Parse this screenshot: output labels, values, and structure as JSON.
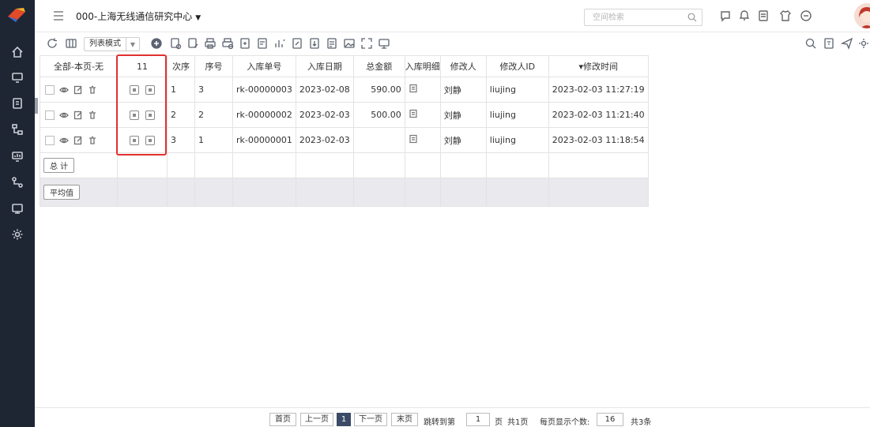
{
  "topbar": {
    "org_name": "000-上海无线通信研究中心",
    "search_placeholder": "空间检索"
  },
  "toolbar": {
    "view_mode": "列表模式"
  },
  "table": {
    "headers": [
      "全部-本页-无",
      "11",
      "次序",
      "序号",
      "入库单号",
      "入库日期",
      "总金额",
      "入库明细",
      "修改人",
      "修改人ID",
      "▾修改时间"
    ],
    "rows": [
      {
        "order": "1",
        "seq": "3",
        "code": "rk-00000003",
        "date": "2023-02-08",
        "amount": "590.00",
        "modifier": "刘静",
        "modifier_id": "liujing",
        "modified_time": "2023-02-03 11:27:19"
      },
      {
        "order": "2",
        "seq": "2",
        "code": "rk-00000002",
        "date": "2023-02-03",
        "amount": "500.00",
        "modifier": "刘静",
        "modifier_id": "liujing",
        "modified_time": "2023-02-03 11:21:40"
      },
      {
        "order": "3",
        "seq": "1",
        "code": "rk-00000001",
        "date": "2023-02-03",
        "amount": "",
        "modifier": "刘静",
        "modifier_id": "liujing",
        "modified_time": "2023-02-03 11:18:54"
      }
    ],
    "total_label": "总 计",
    "average_label": "平均值"
  },
  "pager": {
    "first": "首页",
    "prev": "上一页",
    "current": "1",
    "next": "下一页",
    "last": "末页",
    "jump_label": "跳转到第",
    "jump_value": "1",
    "page_unit": "页",
    "total_pages": "共1页",
    "per_page_label": "每页显示个数:",
    "per_page_value": "16",
    "total_items": "共3条"
  },
  "colors": {
    "rail_bg": "#1f2633",
    "highlight_box": "#e0312f",
    "active_page": "#3b4a66"
  }
}
